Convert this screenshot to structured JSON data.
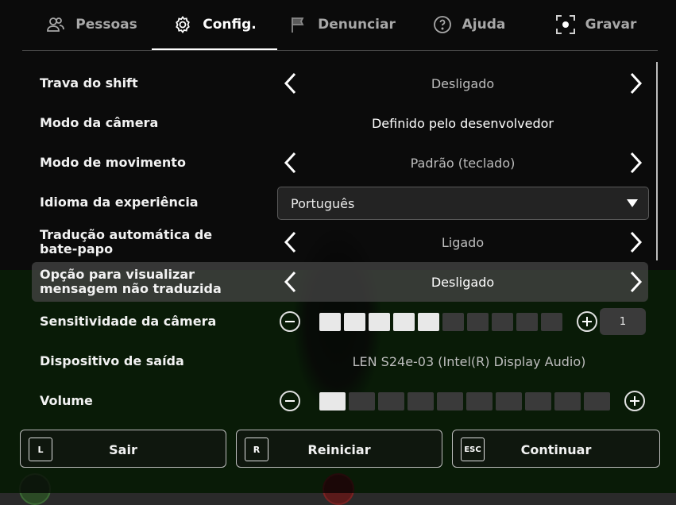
{
  "tabs": [
    {
      "label": "Pessoas",
      "icon": "people-icon"
    },
    {
      "label": "Config.",
      "icon": "gear-icon"
    },
    {
      "label": "Denunciar",
      "icon": "flag-icon"
    },
    {
      "label": "Ajuda",
      "icon": "help-icon"
    },
    {
      "label": "Gravar",
      "icon": "record-icon"
    }
  ],
  "settings": {
    "shift_lock": {
      "label": "Trava do shift",
      "value": "Desligado"
    },
    "camera_mode": {
      "label": "Modo da câmera",
      "value": "Definido pelo desenvolvedor"
    },
    "movement_mode": {
      "label": "Modo de movimento",
      "value": "Padrão (teclado)"
    },
    "language": {
      "label": "Idioma da experiência",
      "value": "Português"
    },
    "auto_translate": {
      "label": "Tradução automática de bate-papo",
      "value": "Ligado"
    },
    "untranslated_option": {
      "label": "Opção para visualizar mensagem não traduzida",
      "value": "Desligado"
    },
    "camera_sensitivity": {
      "label": "Sensitividade da câmera",
      "value": "1",
      "level": 5,
      "max": 10
    },
    "output_device": {
      "label": "Dispositivo de saída",
      "value": "LEN S24e-03 (Intel(R) Display Audio)"
    },
    "volume": {
      "label": "Volume",
      "level": 1,
      "max": 10
    }
  },
  "buttons": {
    "leave": {
      "key": "L",
      "label": "Sair"
    },
    "reset": {
      "key": "R",
      "label": "Reiniciar"
    },
    "resume": {
      "key": "ESC",
      "label": "Continuar"
    }
  }
}
